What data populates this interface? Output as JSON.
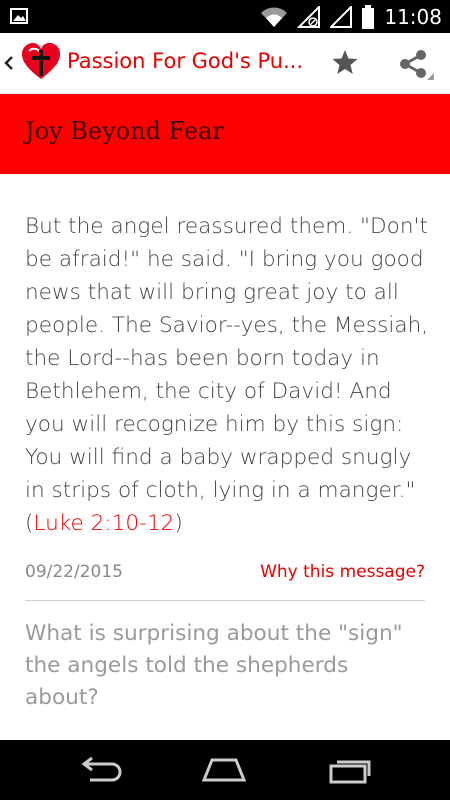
{
  "status_bar": {
    "time": "11:08",
    "icons": [
      "gallery-icon",
      "wifi-icon",
      "signal-icon",
      "battery-icon"
    ]
  },
  "app_bar": {
    "title": "Passion For God's Pu...",
    "icons": [
      "back-chevron-icon",
      "app-logo-heart-cross-icon",
      "star-icon",
      "share-icon"
    ]
  },
  "header": {
    "title": "Joy Beyond Fear",
    "color": "#ff0000"
  },
  "message": {
    "text": "But the angel reassured them. \"Don't be afraid!\" he said. \"I bring you good news that will bring great joy to all people. The Savior--yes, the Messiah, the Lord--has been born today in Bethlehem, the city of David! And you will recognize him by this sign: You will find a baby wrapped snugly in strips of cloth, lying in a manger.\"",
    "open_paren": " (",
    "reference": "Luke 2:10-12",
    "close_paren": ")",
    "date": "09/22/2015",
    "why_link": "Why this message?"
  },
  "question": {
    "text": "What is surprising about the \"sign\" the angels told the shepherds about?"
  },
  "nav_bar": {
    "icons": [
      "back-icon",
      "home-icon",
      "recents-icon"
    ]
  },
  "colors": {
    "accent": "#e60000",
    "status_bar": "#000000",
    "nav_bar": "#000000"
  }
}
